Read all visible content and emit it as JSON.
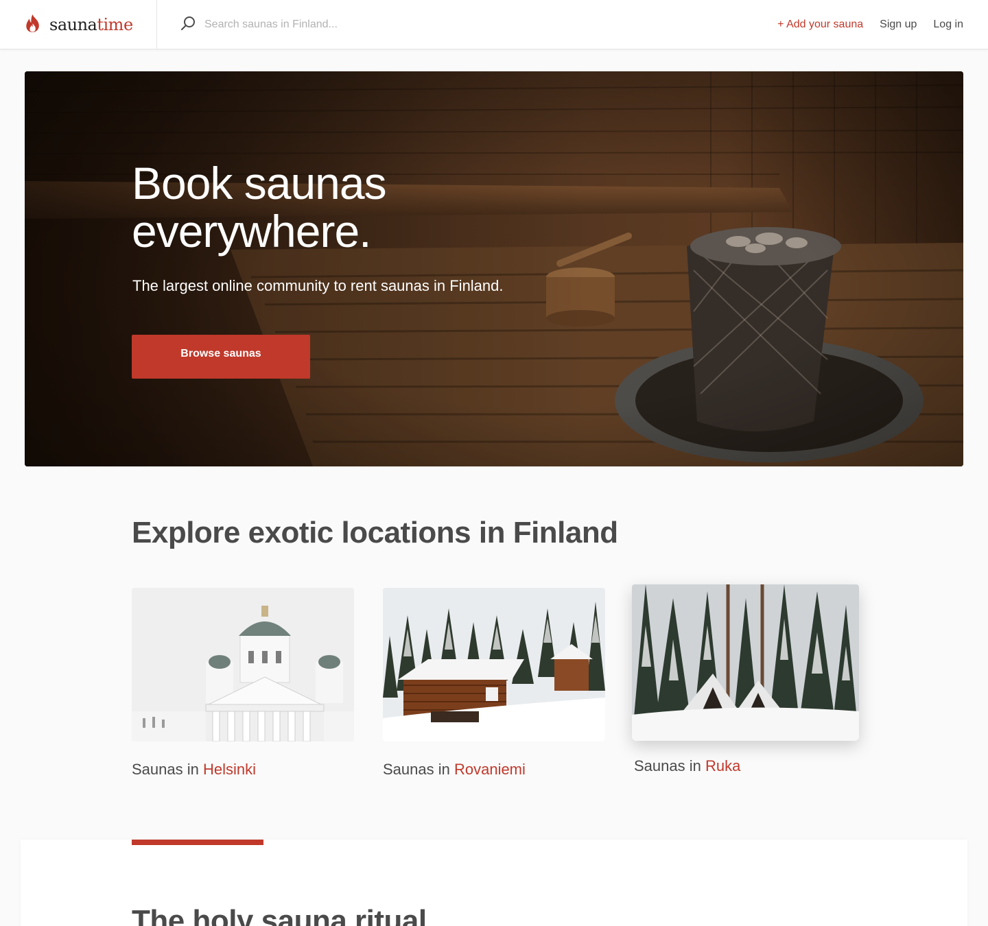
{
  "header": {
    "logo": {
      "part1": "sauna",
      "part2": "time",
      "icon": "flame-icon"
    },
    "search": {
      "placeholder": "Search saunas in Finland...",
      "value": "",
      "icon": "search-icon"
    },
    "nav": {
      "add_sauna": "+ Add your sauna",
      "sign_up": "Sign up",
      "log_in": "Log in"
    }
  },
  "hero": {
    "title": "Book saunas everywhere.",
    "subtitle": "The largest online community to rent saunas in Finland.",
    "cta": "Browse saunas"
  },
  "locations": {
    "title": "Explore exotic locations in Finland",
    "cards": [
      {
        "prefix": "Saunas in ",
        "city": "Helsinki"
      },
      {
        "prefix": "Saunas in ",
        "city": "Rovaniemi"
      },
      {
        "prefix": "Saunas in ",
        "city": "Ruka"
      }
    ]
  },
  "ritual": {
    "title": "The holy sauna ritual"
  },
  "colors": {
    "accent": "#c0392b",
    "text": "#4a4a4a",
    "background": "#fafafa"
  }
}
